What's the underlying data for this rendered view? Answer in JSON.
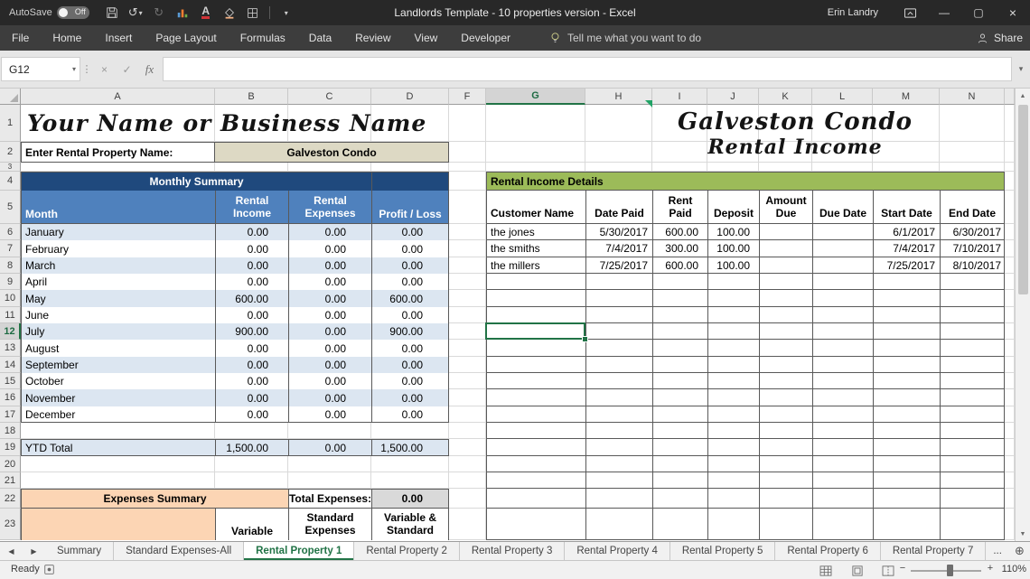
{
  "title_bar": {
    "autosave_label": "AutoSave",
    "autosave_state": "Off",
    "title": "Landlords Template - 10 properties version - Excel",
    "user": "Erin Landry"
  },
  "ribbon": {
    "tabs": [
      "File",
      "Home",
      "Insert",
      "Page Layout",
      "Formulas",
      "Data",
      "Review",
      "View",
      "Developer"
    ],
    "tell_me": "Tell me what you want to do",
    "share_label": "Share"
  },
  "formula_bar": {
    "name_box": "G12",
    "fx_label": "fx",
    "formula": ""
  },
  "grid": {
    "visible_columns": [
      "A",
      "B",
      "C",
      "D",
      "F",
      "G",
      "H",
      "I",
      "J",
      "K",
      "L",
      "M",
      "N"
    ],
    "selected_cell": "G12",
    "selected_column": "G",
    "selected_row": "12"
  },
  "sheet_content": {
    "business_name": "Your Name or Business Name",
    "property_title": "Galveston Condo",
    "property_subtitle": "Rental Income",
    "property_name_label": "Enter Rental Property Name:",
    "property_name_value": "Galveston Condo",
    "monthly_summary": {
      "title": "Monthly Summary",
      "col_month": "Month",
      "col_income": "Rental Income",
      "col_expenses": "Rental Expenses",
      "col_profit": "Profit / Loss",
      "rows": [
        {
          "month": "January",
          "income": "0.00",
          "expenses": "0.00",
          "profit": "0.00"
        },
        {
          "month": "February",
          "income": "0.00",
          "expenses": "0.00",
          "profit": "0.00"
        },
        {
          "month": "March",
          "income": "0.00",
          "expenses": "0.00",
          "profit": "0.00"
        },
        {
          "month": "April",
          "income": "0.00",
          "expenses": "0.00",
          "profit": "0.00"
        },
        {
          "month": "May",
          "income": "600.00",
          "expenses": "0.00",
          "profit": "600.00"
        },
        {
          "month": "June",
          "income": "0.00",
          "expenses": "0.00",
          "profit": "0.00"
        },
        {
          "month": "July",
          "income": "900.00",
          "expenses": "0.00",
          "profit": "900.00"
        },
        {
          "month": "August",
          "income": "0.00",
          "expenses": "0.00",
          "profit": "0.00"
        },
        {
          "month": "September",
          "income": "0.00",
          "expenses": "0.00",
          "profit": "0.00"
        },
        {
          "month": "October",
          "income": "0.00",
          "expenses": "0.00",
          "profit": "0.00"
        },
        {
          "month": "November",
          "income": "0.00",
          "expenses": "0.00",
          "profit": "0.00"
        },
        {
          "month": "December",
          "income": "0.00",
          "expenses": "0.00",
          "profit": "0.00"
        }
      ],
      "ytd_label": "YTD Total",
      "ytd_income": "1,500.00",
      "ytd_expenses": "0.00",
      "ytd_profit": "1,500.00"
    },
    "expenses_summary": {
      "title": "Expenses Summary",
      "total_label": "Total Expenses:",
      "total_value": "0.00",
      "col_variable": "Variable",
      "col_standard": "Standard Expenses",
      "col_both": "Variable & Standard"
    },
    "rental_details": {
      "title": "Rental Income Details",
      "headers": [
        "Customer Name",
        "Date Paid",
        "Rent Paid",
        "Deposit",
        "Amount Due",
        "Due Date",
        "Start Date",
        "End Date"
      ],
      "rows": [
        {
          "customer": "the jones",
          "date_paid": "5/30/2017",
          "rent": "600.00",
          "deposit": "100.00",
          "amount_due": "",
          "due_date": "",
          "start_date": "6/1/2017",
          "end_date": "6/30/2017"
        },
        {
          "customer": "the smiths",
          "date_paid": "7/4/2017",
          "rent": "300.00",
          "deposit": "100.00",
          "amount_due": "",
          "due_date": "",
          "start_date": "7/4/2017",
          "end_date": "7/10/2017"
        },
        {
          "customer": "the millers",
          "date_paid": "7/25/2017",
          "rent": "600.00",
          "deposit": "100.00",
          "amount_due": "",
          "due_date": "",
          "start_date": "7/25/2017",
          "end_date": "8/10/2017"
        }
      ]
    }
  },
  "sheet_tabs": {
    "items": [
      "Summary",
      "Standard Expenses-All",
      "Rental Property 1",
      "Rental Property 2",
      "Rental Property 3",
      "Rental Property 4",
      "Rental Property 5",
      "Rental Property 6",
      "Rental Property 7"
    ],
    "active": "Rental Property 1",
    "overflow": "..."
  },
  "status_bar": {
    "status": "Ready",
    "zoom_out": "−",
    "zoom_in": "+",
    "zoom": "110%"
  },
  "colors": {
    "accent_green": "#217346",
    "header_dark_blue": "#1F497D",
    "header_blue": "#4F81BD",
    "detail_green": "#9CBB59",
    "peach": "#FCD5B4",
    "row_shade": "#DCE6F1",
    "beige": "#DDD9C4"
  }
}
